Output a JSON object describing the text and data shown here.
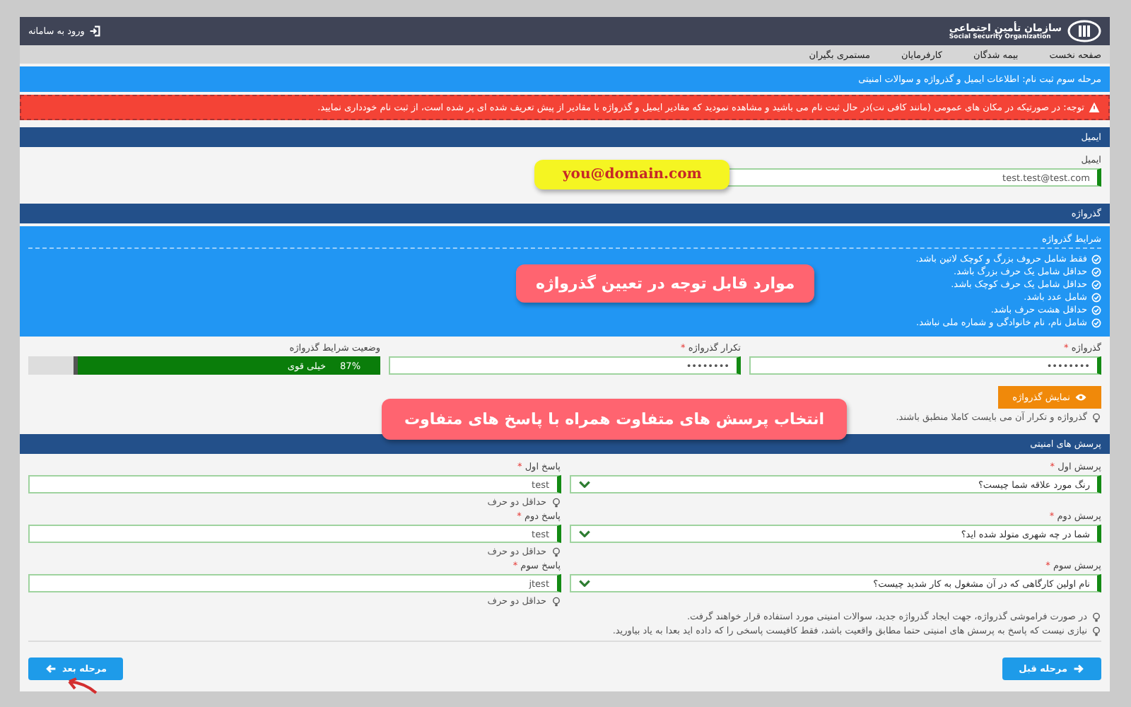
{
  "header": {
    "logo_title": "سازمان تأمین اجتماعی",
    "logo_subtitle": "Social Security Organization",
    "login_link": "ورود به سامانه"
  },
  "nav": [
    {
      "label": "صفحه نخست"
    },
    {
      "label": "بیمه شدگان"
    },
    {
      "label": "کارفرمایان"
    },
    {
      "label": "مستمری بگیران"
    }
  ],
  "step_title": "مرحله سوم ثبت نام: اطلاعات ایمیل و گذرواژه و سوالات امنیتی",
  "alert": "توجه: در صورتیکه در مکان های عمومی (مانند کافی نت)در حال ثبت نام می باشید و مشاهده نمودید که مقادیر ایمیل و گذرواژه با مقادیر از پیش تعریف شده ای پر شده است، از ثبت نام خودداری نمایید.",
  "email_section": {
    "title": "ایمیل",
    "label": "ایمیل",
    "value": "test.test@test.com"
  },
  "password_section": {
    "title": "گذرواژه",
    "conditions_title": "شرایط گذرواژه",
    "conditions": [
      "فقط شامل حروف بزرگ و کوچک لاتین باشد.",
      "حداقل شامل یک حرف بزرگ باشد.",
      "حداقل شامل یک حرف کوچک باشد.",
      "شامل عدد باشد.",
      "حداقل هشت حرف باشد.",
      "شامل نام، نام خانوادگی و شماره ملی نباشد."
    ],
    "password": {
      "label": "گذرواژه",
      "required_mark": "*",
      "value": "••••••••"
    },
    "repeat": {
      "label": "تکرار گذرواژه",
      "required_mark": "*",
      "value": "••••••••"
    },
    "strength": {
      "label": "وضعیت شرایط گذرواژه",
      "level": 0.87,
      "percent": "87%",
      "text": "خیلی قوی"
    },
    "show_button": "نمایش گذرواژه",
    "hint": "گذرواژه و تکرار آن می بایست کاملا منطبق باشند."
  },
  "security_section": {
    "title": "پرسش های امنیتی",
    "questions": [
      {
        "question_label": "پرسش اول",
        "question_mark": "*",
        "question": "رنگ مورد علاقه شما چیست؟",
        "answer_label": "پاسخ اول",
        "answer_mark": "*",
        "answer": "test",
        "hint": "حداقل دو حرف"
      },
      {
        "question_label": "پرسش دوم",
        "question_mark": "*",
        "question": "شما در چه شهری متولد شده اید؟",
        "answer_label": "پاسخ دوم",
        "answer_mark": "*",
        "answer": "test",
        "hint": "حداقل دو حرف"
      },
      {
        "question_label": "پرسش سوم",
        "question_mark": "*",
        "question": "نام اولین کارگاهی که در آن مشغول به کار شدید چیست؟",
        "answer_label": "پاسخ سوم",
        "answer_mark": "*",
        "answer": "jtest",
        "hint": "حداقل دو حرف"
      }
    ],
    "notes": [
      "در صورت فراموشی گذرواژه، جهت ایجاد گذرواژه جدید، سوالات امنیتی مورد استفاده قرار خواهند گرفت.",
      "نیازی نیست که پاسخ به پرسش های امنیتی حتما مطابق واقعیت باشد، فقط کافیست پاسخی را که داده اید بعدا به یاد بیاورید."
    ]
  },
  "buttons": {
    "previous": "مرحله قبل",
    "next": "مرحله بعد"
  },
  "callouts": [
    {
      "kind": "email",
      "text": "you@domain.com"
    },
    {
      "kind": "password",
      "text": "موارد قابل توجه در تعیین گذرواژه"
    },
    {
      "kind": "questions",
      "text": "انتخاب پرسش های متفاوت همراه با پاسخ های متفاوت"
    }
  ]
}
